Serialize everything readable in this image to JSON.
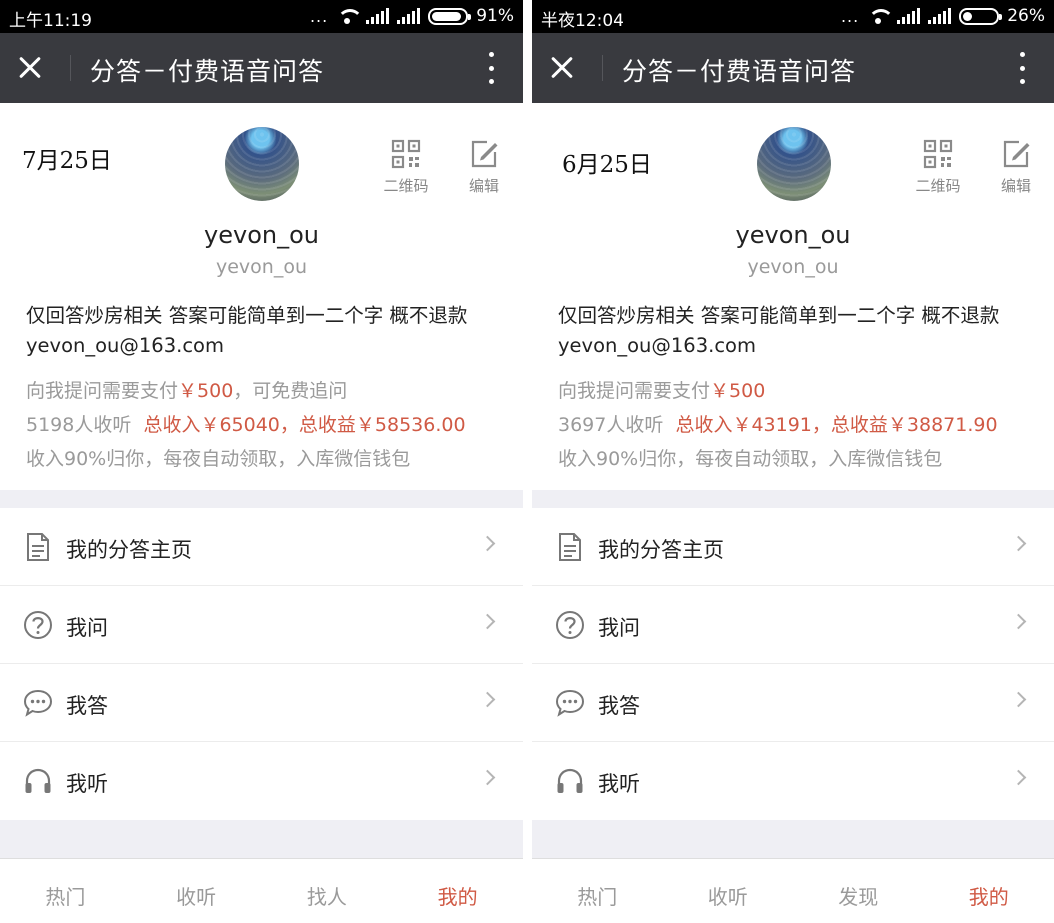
{
  "colors": {
    "accent": "#d05a45",
    "titlebar": "#393a3f",
    "muted": "#9a9a9a"
  },
  "left": {
    "status": {
      "time": "上午11:19",
      "signal_dots": "...",
      "battery": "91%",
      "battery_level": 0.91
    },
    "titlebar": {
      "title": "分答－付费语音问答"
    },
    "profile": {
      "date_note": "7月25日",
      "qr_label": "二维码",
      "edit_label": "编辑",
      "username": "yevon_ou",
      "handle": "yevon_ou",
      "bio_line1": "仅回答炒房相关 答案可能简单到一二个字 概不退款",
      "bio_line2": "yevon_ou@163.com",
      "price_prefix": "向我提问需要支付",
      "price": "￥500",
      "price_suffix": "，可免费追问",
      "listeners": "5198人收听",
      "income": "总收入￥65040，总收益￥58536.00",
      "payout_note": "收入90%归你，每夜自动领取，入库微信钱包"
    },
    "menu": [
      {
        "label": "我的分答主页",
        "icon": "document-icon"
      },
      {
        "label": "我问",
        "icon": "question-icon"
      },
      {
        "label": "我答",
        "icon": "chat-icon"
      },
      {
        "label": "我听",
        "icon": "headphones-icon"
      }
    ],
    "tabs": [
      "热门",
      "收听",
      "找人",
      "我的"
    ]
  },
  "right": {
    "status": {
      "time": "半夜12:04",
      "signal_dots": "...",
      "battery": "26%",
      "battery_level": 0.26
    },
    "titlebar": {
      "title": "分答－付费语音问答"
    },
    "profile": {
      "date_note": "6月25日",
      "qr_label": "二维码",
      "edit_label": "编辑",
      "username": "yevon_ou",
      "handle": "yevon_ou",
      "bio_line1": "仅回答炒房相关 答案可能简单到一二个字 概不退款",
      "bio_line2": "yevon_ou@163.com",
      "price_prefix": "向我提问需要支付",
      "price": "￥500",
      "price_suffix": "",
      "listeners": "3697人收听",
      "income": "总收入￥43191，总收益￥38871.90",
      "payout_note": "收入90%归你，每夜自动领取，入库微信钱包"
    },
    "menu": [
      {
        "label": "我的分答主页",
        "icon": "document-icon"
      },
      {
        "label": "我问",
        "icon": "question-icon"
      },
      {
        "label": "我答",
        "icon": "chat-icon"
      },
      {
        "label": "我听",
        "icon": "headphones-icon"
      }
    ],
    "tabs": [
      "热门",
      "收听",
      "发现",
      "我的"
    ]
  }
}
